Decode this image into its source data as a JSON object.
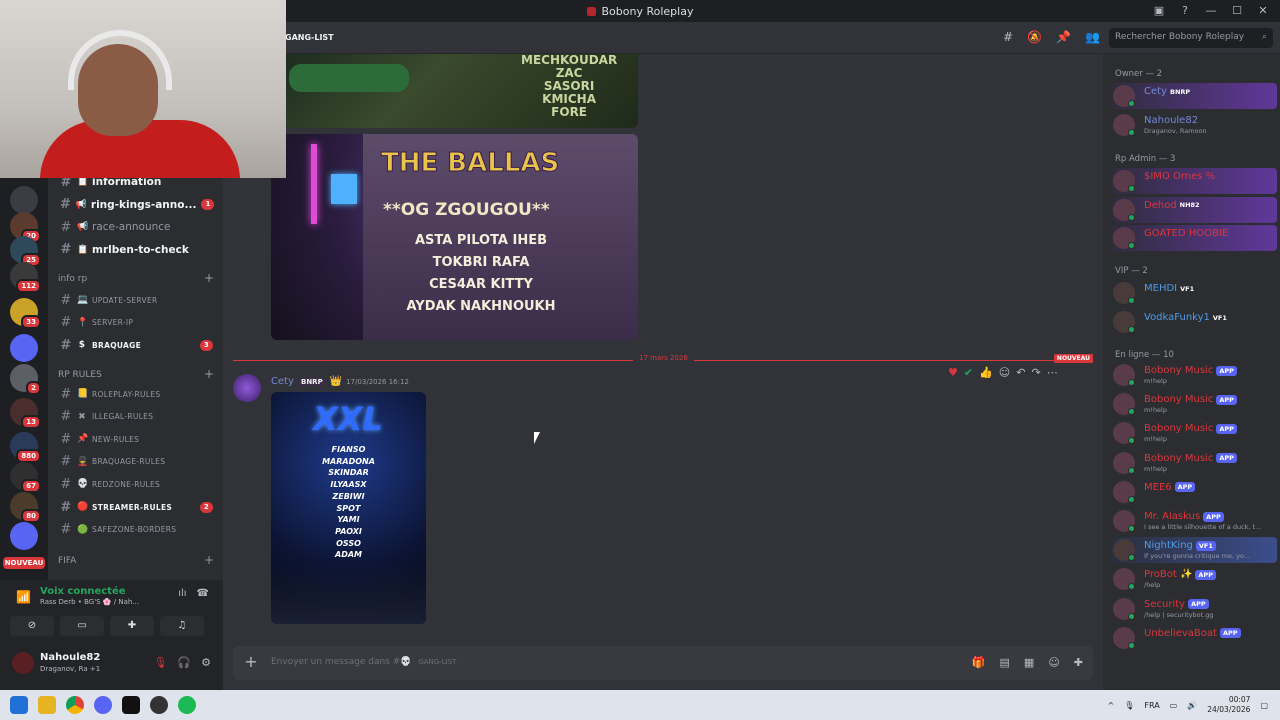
{
  "window": {
    "title": "Bobony Roleplay"
  },
  "header": {
    "channel_name": "GANG-LIST",
    "search_placeholder": "Rechercher Bobony Roleplay"
  },
  "servers": [
    {
      "badge": ""
    },
    {
      "badge": "20"
    },
    {
      "badge": "25"
    },
    {
      "badge": "112"
    },
    {
      "badge": "33"
    },
    {
      "badge": ""
    },
    {
      "badge": "2"
    },
    {
      "badge": "13"
    },
    {
      "badge": "880"
    },
    {
      "badge": "67"
    },
    {
      "badge": "80"
    },
    {
      "badge": ""
    }
  ],
  "rail_new_label": "NOUVEAU",
  "channels": {
    "top": [
      {
        "name": "information",
        "emoji": "📋",
        "bold": true,
        "count": ""
      },
      {
        "name": "ring-kings-anno...",
        "emoji": "📢",
        "bold": true,
        "count": "1"
      },
      {
        "name": "race-announce",
        "emoji": "📢",
        "bold": false,
        "count": ""
      },
      {
        "name": "mrlben-to-check",
        "emoji": "📋",
        "bold": true,
        "count": ""
      }
    ],
    "category_info": "info rp",
    "info": [
      {
        "name": "UPDATE-SERVER",
        "emoji": "💻",
        "bold": false,
        "count": ""
      },
      {
        "name": "SERVER-IP",
        "emoji": "📍",
        "bold": false,
        "count": ""
      },
      {
        "name": "BRAQUAGE",
        "emoji": "$",
        "bold": true,
        "count": "3"
      }
    ],
    "category_rules": "RP RULES",
    "rules": [
      {
        "name": "ROLEPLAY-RULES",
        "emoji": "📒",
        "bold": false,
        "count": ""
      },
      {
        "name": "ILLEGAL-RULES",
        "emoji": "✖",
        "bold": false,
        "count": ""
      },
      {
        "name": "NEW-RULES",
        "emoji": "📌",
        "bold": false,
        "count": ""
      },
      {
        "name": "BRAQUAGE-RULES",
        "emoji": "💂",
        "bold": false,
        "count": ""
      },
      {
        "name": "REDZONE-RULES",
        "emoji": "💀",
        "bold": false,
        "count": ""
      },
      {
        "name": "STREAMER-RULES",
        "emoji": "🔴",
        "bold": true,
        "count": "2"
      },
      {
        "name": "SAFEZONE-BORDERS",
        "emoji": "🟢",
        "bold": false,
        "count": ""
      }
    ],
    "category_fifa": "FIFA"
  },
  "voice": {
    "title": "Voix connectée",
    "subtitle": "Rass Derb • BG'S 🌸 / Nah..."
  },
  "user": {
    "name": "Nahoule82",
    "status": "Draganov, Ra +1"
  },
  "messages": {
    "image1_text": [
      "MECHKOUDAR",
      "ZAC",
      "SASORI",
      "KMICHA",
      "FORE"
    ],
    "image2": {
      "title": "THE BALLAS",
      "leader": "**OG ZGOUGOU**",
      "names": [
        "ASTA PILOTA",
        "IHEB",
        "TOKBRI",
        "RAFA",
        "CES4AR",
        "KITTY",
        "AYDAK",
        "NAKHNOUKH"
      ]
    },
    "divider_date": "17 mars 2026",
    "new_label": "NOUVEAU",
    "post": {
      "author": "Cety",
      "tag": "BNRP",
      "timestamp": "17/03/2026 16:12",
      "image_logo": "XXL",
      "image_names": [
        "FIANSO",
        "MARADONA",
        "SKINDAR",
        "ILYAASX",
        "ZEBIWI",
        "SPOT",
        "YAMI",
        "PAOXI",
        "OSSO",
        "ADAM"
      ]
    }
  },
  "composer": {
    "placeholder": "Envoyer un message dans #💀",
    "channel": "GANG-LIST"
  },
  "members": {
    "categories": [
      "Owner — 2",
      "Rp Admin — 3",
      "VIP — 2",
      "En ligne — 10"
    ],
    "owner": [
      {
        "name": "Cety",
        "tag": "BNRP",
        "status": "",
        "color": "#7289da"
      },
      {
        "name": "Nahoule82",
        "tag": "",
        "status": "Draganov, Ramoon",
        "color": "#7289da"
      }
    ],
    "admin": [
      {
        "name": "$IMO Ornes %",
        "tag": "",
        "status": "",
        "color": "#da373c"
      },
      {
        "name": "Dehod",
        "tag": "NH82",
        "status": "",
        "color": "#da373c"
      },
      {
        "name": "GOATED HOOBIE",
        "tag": "",
        "status": "",
        "color": "#da373c"
      }
    ],
    "vip": [
      {
        "name": "MEHDI",
        "tag": "VF1",
        "status": "",
        "color": "#4e9ce8"
      },
      {
        "name": "VodkaFunky1",
        "tag": "VF1",
        "status": "",
        "color": "#4e9ce8"
      }
    ],
    "online": [
      {
        "name": "Bobony Music",
        "app": "APP",
        "status": "m!help",
        "color": "#da373c"
      },
      {
        "name": "Bobony Music",
        "app": "APP",
        "status": "m!help",
        "color": "#da373c"
      },
      {
        "name": "Bobony Music",
        "app": "APP",
        "status": "m!help",
        "color": "#da373c"
      },
      {
        "name": "Bobony Music",
        "app": "APP",
        "status": "m!help",
        "color": "#da373c"
      },
      {
        "name": "MEE6",
        "app": "APP",
        "status": "",
        "color": "#da373c"
      },
      {
        "name": "Mr. Alaskus",
        "app": "APP",
        "status": "I see a little silhouette of a duck, t...",
        "color": "#da373c"
      },
      {
        "name": "NightKing",
        "app": "VF1",
        "status": "If you're gonna critique me, yo...",
        "color": "#4e9ce8"
      },
      {
        "name": "ProBot ✨",
        "app": "APP",
        "status": "/help",
        "color": "#da373c"
      },
      {
        "name": "Security",
        "app": "APP",
        "status": "/help | securitybot.gg",
        "color": "#da373c"
      },
      {
        "name": "UnbelievaBoat",
        "app": "APP",
        "status": "",
        "color": "#da373c"
      }
    ]
  },
  "taskbar": {
    "lang": "FRA",
    "time": "00:07",
    "date": "24/03/2026"
  }
}
